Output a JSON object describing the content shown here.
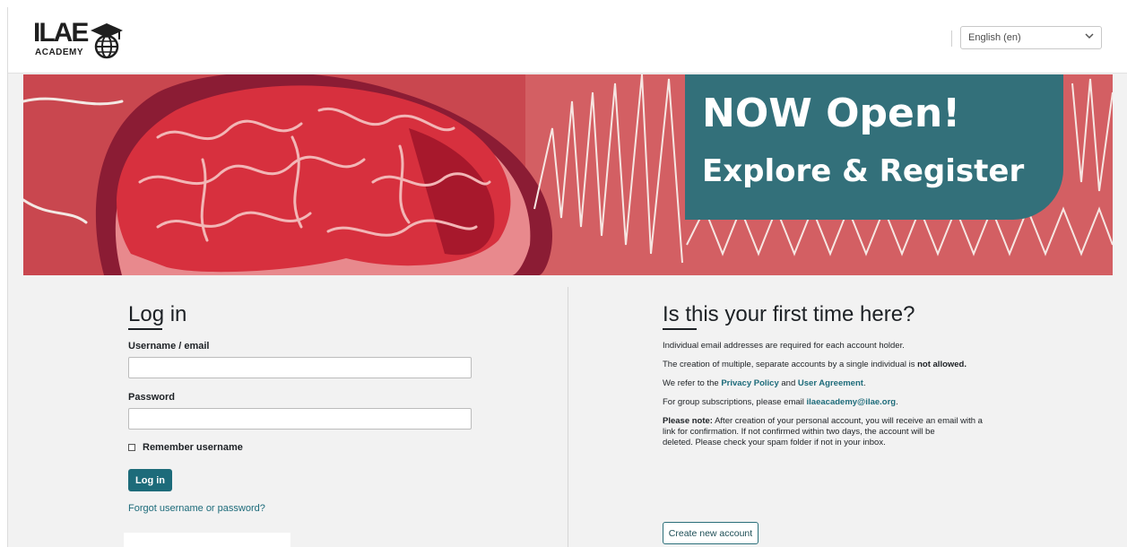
{
  "header": {
    "logo_main": "ILAE",
    "logo_sub": "ACADEMY",
    "language": "English (en)"
  },
  "banner": {
    "line1": "NOW Open!",
    "line2": "Explore & Register"
  },
  "login": {
    "title": "Log in",
    "username_label": "Username / email",
    "username_value": "",
    "password_label": "Password",
    "password_value": "",
    "remember_label": "Remember username",
    "login_button": "Log in",
    "forgot_link": "Forgot username or password?"
  },
  "signup": {
    "title": "Is this your first time here?",
    "line1": "Individual email addresses are required for each account holder.",
    "line2_prefix": "The creation of multiple, separate accounts by a single individual is ",
    "line2_bold": "not allowed.",
    "line3_prefix": "We refer to the ",
    "privacy_link": "Privacy Policy",
    "line3_and": " and ",
    "agreement_link": "User Agreement",
    "line3_suffix": ".",
    "line4_prefix": "For group subscriptions, please email ",
    "email_link": "ilaeacademy@ilae.org",
    "line4_suffix": ".",
    "note_bold": "Please note:",
    "note_line1": " After creation of your personal account, you will receive an email with a",
    "note_line2": "link for confirmation. If not confirmed within two days, the account will be",
    "note_line3": "deleted. Please check your spam folder if not in your inbox.",
    "create_button": "Create new account"
  },
  "colors": {
    "accent": "#1d6b7a",
    "banner_box": "#33707a",
    "banner_bg": "#c4444d"
  }
}
